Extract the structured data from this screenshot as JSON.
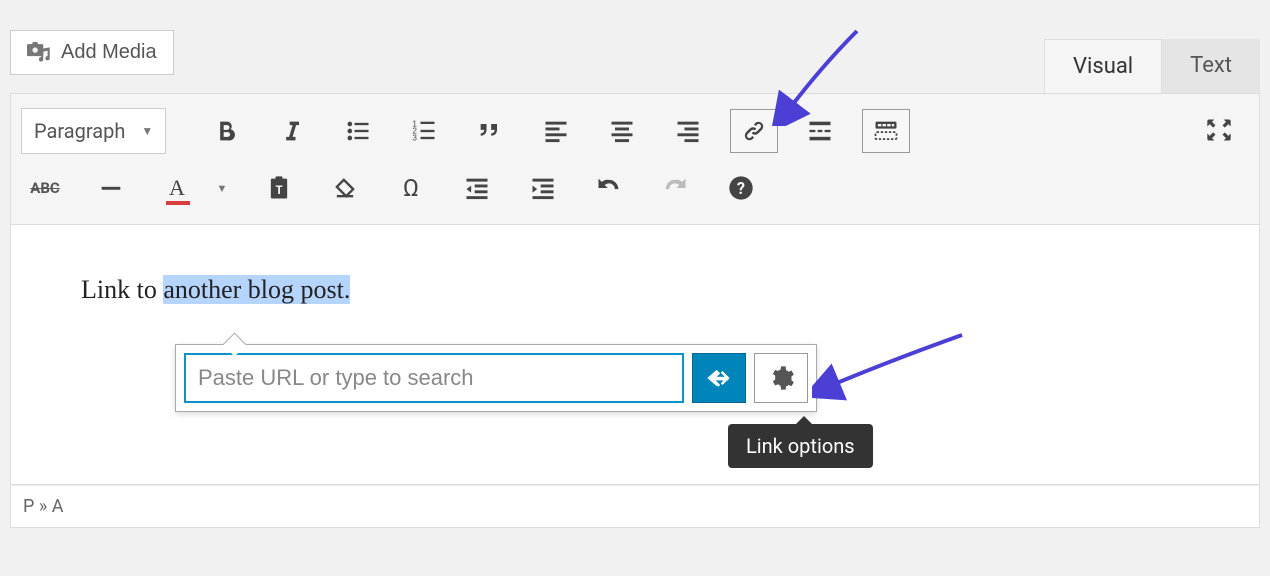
{
  "add_media_label": "Add Media",
  "tabs": {
    "visual": "Visual",
    "text": "Text"
  },
  "format_selector": "Paragraph",
  "content": {
    "before": "Link to ",
    "highlighted": "another blog post.",
    "after": ""
  },
  "link_popup": {
    "placeholder": "Paste URL or type to search",
    "value": ""
  },
  "tooltip": "Link options",
  "status_path": "P » A"
}
